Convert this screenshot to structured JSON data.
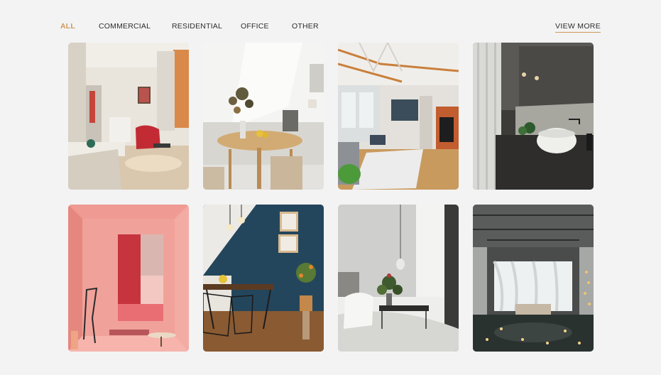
{
  "filters": {
    "items": [
      {
        "label": "ALL",
        "active": true
      },
      {
        "label": "COMMERCIAL",
        "active": false
      },
      {
        "label": "RESIDENTIAL",
        "active": false
      },
      {
        "label": "OFFICE",
        "active": false
      },
      {
        "label": "OTHER",
        "active": false
      }
    ],
    "view_more": "VIEW MORE"
  },
  "colors": {
    "accent": "#d29858",
    "text": "#2d2d2d",
    "background": "#f3f3f3"
  },
  "gallery": {
    "images": [
      {
        "name": "living-room-red-armchair-image"
      },
      {
        "name": "dining-table-flowers-image"
      },
      {
        "name": "loft-fireplace-image"
      },
      {
        "name": "dark-bathroom-sink-image"
      },
      {
        "name": "pink-room-image"
      },
      {
        "name": "blue-wall-dining-image"
      },
      {
        "name": "bedroom-plant-image"
      },
      {
        "name": "industrial-loft-candles-image"
      }
    ]
  }
}
